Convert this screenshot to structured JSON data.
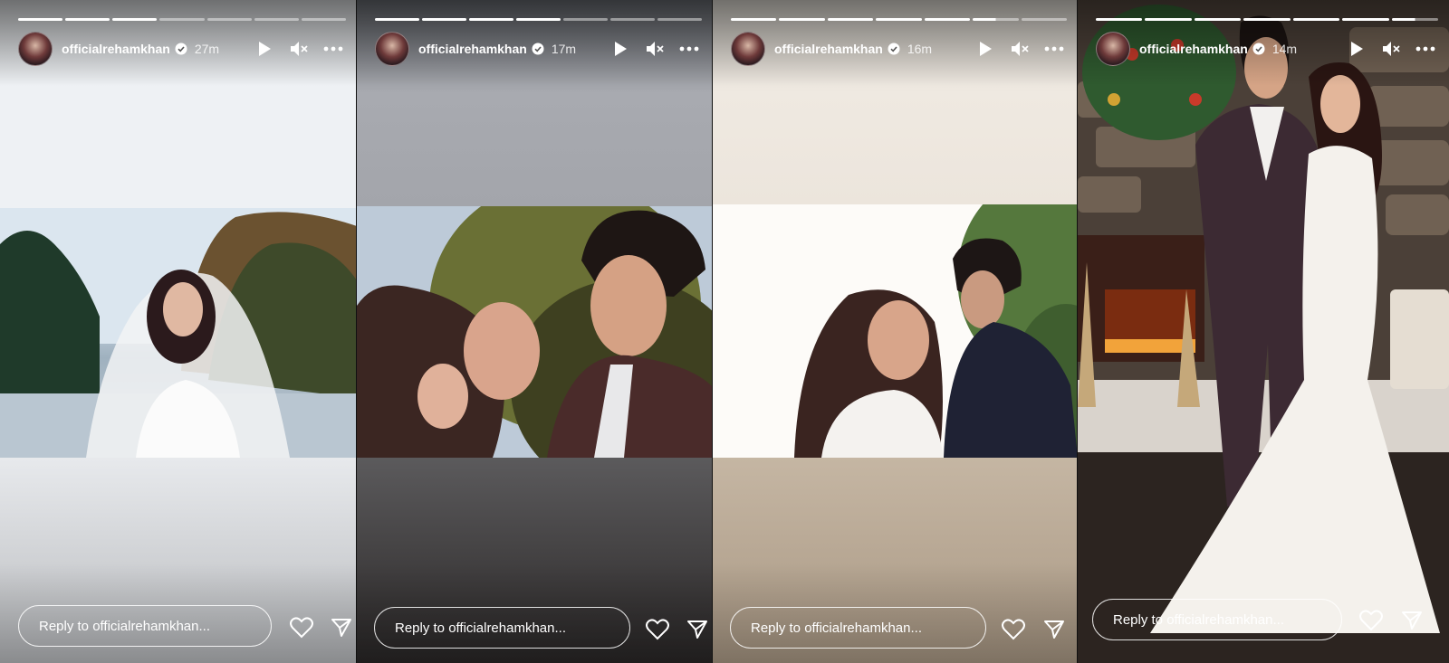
{
  "stories": [
    {
      "username": "officialrehamkhan",
      "time": "27m",
      "reply_placeholder": "Reply to officialrehamkhan...",
      "progress": {
        "done": 2,
        "current": 3,
        "total": 7
      },
      "photo_icon": "bride-portrait-photo"
    },
    {
      "username": "officialrehamkhan",
      "time": "17m",
      "reply_placeholder": "Reply to officialrehamkhan...",
      "progress": {
        "done": 4,
        "current": 5,
        "total": 7
      },
      "photo_icon": "couple-closeup-photo"
    },
    {
      "username": "officialrehamkhan",
      "time": "16m",
      "reply_placeholder": "Reply to officialrehamkhan...",
      "progress": {
        "done": 5,
        "current": 6,
        "total": 7
      },
      "photo_icon": "couple-sunlight-photo"
    },
    {
      "username": "officialrehamkhan",
      "time": "14m",
      "reply_placeholder": "Reply to officialrehamkhan...",
      "progress": {
        "done": 6,
        "current": 7,
        "total": 7
      },
      "photo_icon": "couple-fireplace-photo"
    }
  ],
  "colors": {
    "text": "#ffffff",
    "verified_badge": "#ffffff",
    "progress_bar": "#ffffff"
  },
  "icons": [
    "verified-icon",
    "play-icon",
    "mute-icon",
    "more-icon",
    "heart-icon",
    "send-icon"
  ]
}
